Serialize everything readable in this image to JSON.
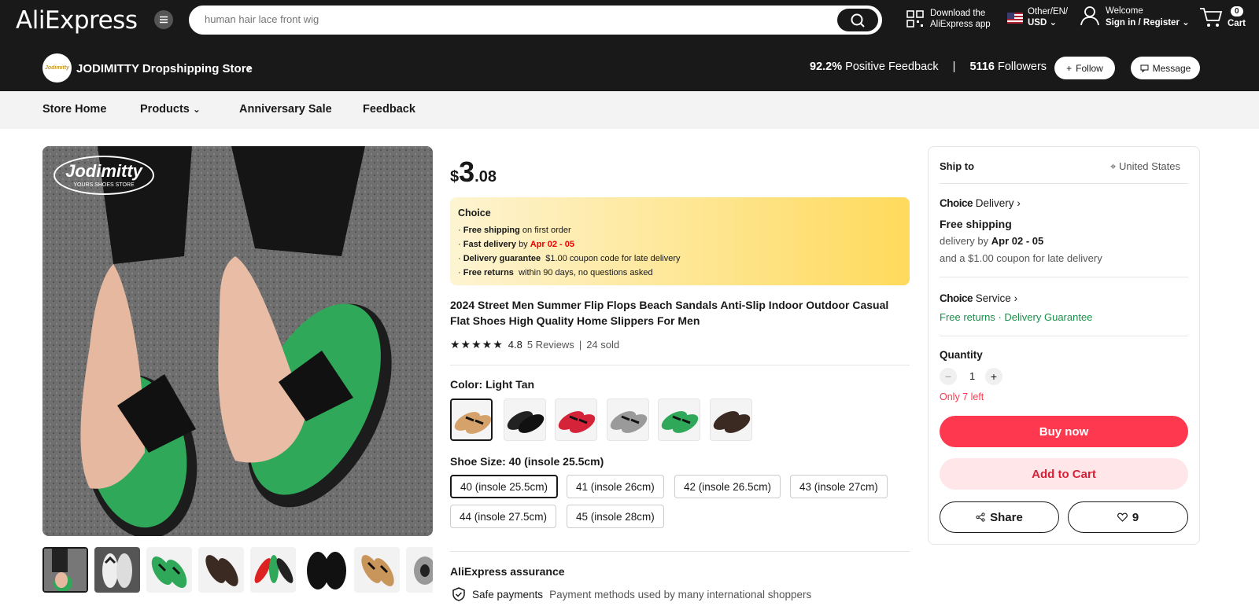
{
  "header": {
    "logo": "AliExpress",
    "search_placeholder": "human hair lace front wig",
    "app_line1": "Download the",
    "app_line2": "AliExpress app",
    "lang_line1": "Other/EN/",
    "lang_line2": "USD",
    "account_line1": "Welcome",
    "account_line2": "Sign in / Register",
    "cart_count": "0",
    "cart_label": "Cart"
  },
  "store": {
    "logo_text": "Jodimitty",
    "name": "JODIMITTY Dropshipping Store",
    "feedback_value": "92.2%",
    "feedback_label": "Positive Feedback",
    "separator": "|",
    "followers_value": "5116",
    "followers_label": "Followers",
    "follow_label": "Follow",
    "message_label": "Message"
  },
  "nav": {
    "items": [
      "Store Home",
      "Products",
      "Anniversary Sale",
      "Feedback"
    ]
  },
  "gallery": {
    "watermark": "Jodimitty",
    "watermark_sub": "YOURS SHOES STORE"
  },
  "product": {
    "currency": "$",
    "price_int": "3",
    "price_dec": ".08",
    "choice": {
      "title": "Choice",
      "l1_bold": "Free shipping",
      "l1_rest": "on first order",
      "l2_bold": "Fast delivery",
      "l2_mid": "by",
      "l2_red": "Apr 02 - 05",
      "l3_bold": "Delivery guarantee",
      "l3_rest": "$1.00 coupon code for late delivery",
      "l4_bold": "Free returns",
      "l4_rest": "within 90 days, no questions asked"
    },
    "title": "2024 Street Men Summer Flip Flops Beach Sandals Anti-Slip Indoor Outdoor Casual Flat Shoes High Quality Home Slippers For Men",
    "rating": "4.8",
    "reviews": "5 Reviews",
    "sold": "24 sold",
    "color_label": "Color: Light Tan",
    "size_label": "Shoe Size: 40 (insole 25.5cm)",
    "sizes": [
      "40 (insole 25.5cm)",
      "41 (insole 26cm)",
      "42 (insole 26.5cm)",
      "43 (insole 27cm)",
      "44 (insole 27.5cm)",
      "45 (insole 28cm)"
    ],
    "assurance_title": "AliExpress assurance",
    "assurance_item": "Safe payments",
    "assurance_desc": "Payment methods used by many international shoppers"
  },
  "panel": {
    "ship_to": "Ship to",
    "country": "United States",
    "choice_word": "Choice",
    "delivery_word": "Delivery",
    "free_shipping": "Free shipping",
    "delivery_by": "delivery by",
    "delivery_date": "Apr 02 - 05",
    "coupon_line": "and a $1.00 coupon for late delivery",
    "service_word": "Service",
    "free_returns": "Free returns",
    "dot": "·",
    "delivery_guarantee": "Delivery Guarantee",
    "quantity_label": "Quantity",
    "quantity": "1",
    "stock": "Only 7 left",
    "buy_now": "Buy now",
    "add_to_cart": "Add to Cart",
    "share": "Share",
    "wishlist_count": "9"
  },
  "colors": {
    "brand_dark": "#191919",
    "buy_red": "#fd384f",
    "cart_pink": "#ffe7e9",
    "choice_yellow": "#ffda5c",
    "green": "#1a8f4a",
    "stock_red": "#fd384f"
  }
}
